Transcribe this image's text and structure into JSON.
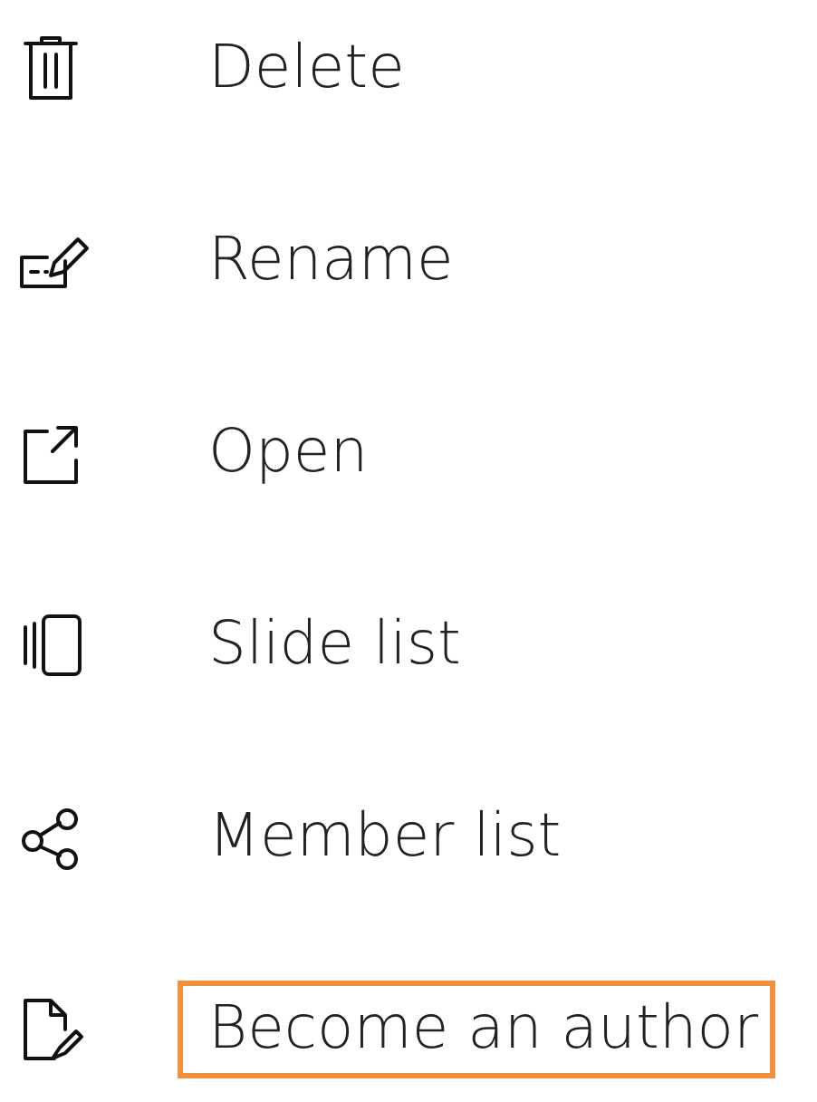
{
  "menu": [
    {
      "kind": "delete",
      "label": "Delete",
      "selected": false
    },
    {
      "kind": "rename",
      "label": "Rename",
      "selected": false
    },
    {
      "kind": "open",
      "label": "Open",
      "selected": false
    },
    {
      "kind": "slides",
      "label": "Slide list",
      "selected": false
    },
    {
      "kind": "share",
      "label": "Member list",
      "selected": false
    },
    {
      "kind": "author",
      "label": "Become an author",
      "selected": true
    }
  ]
}
